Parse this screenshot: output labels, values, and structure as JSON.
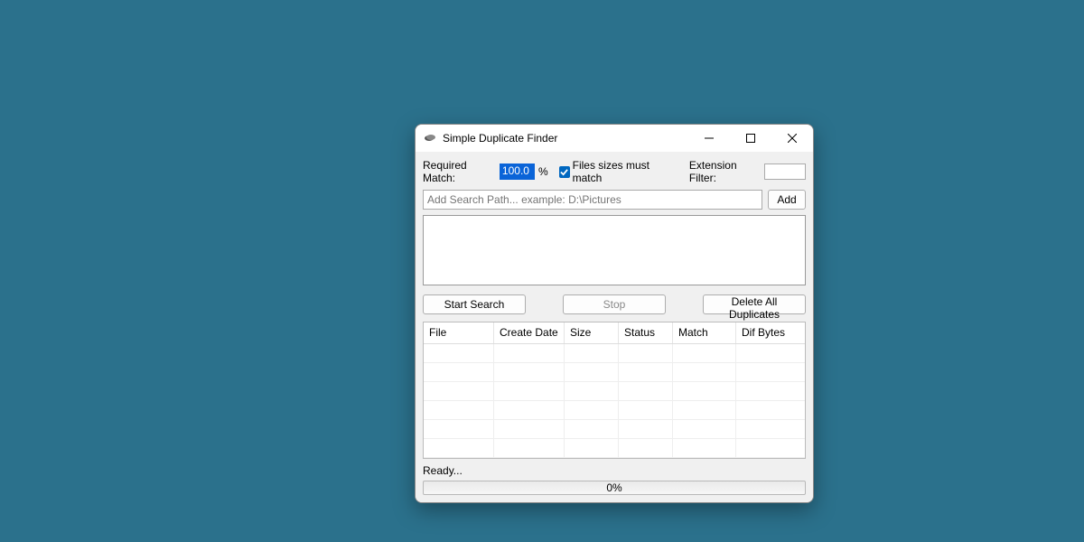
{
  "window": {
    "title": "Simple Duplicate Finder"
  },
  "settings": {
    "required_match_label": "Required Match:",
    "required_match_value": "100.0",
    "percent_sign": "%",
    "sizes_must_match_label": "Files sizes must match",
    "sizes_must_match_checked": true,
    "extension_filter_label": "Extension Filter:",
    "extension_filter_value": ""
  },
  "path": {
    "placeholder": "Add Search Path... example: D:\\Pictures",
    "add_label": "Add"
  },
  "actions": {
    "start_label": "Start Search",
    "stop_label": "Stop",
    "delete_label": "Delete All Duplicates"
  },
  "grid": {
    "columns": {
      "file": "File",
      "create_date": "Create Date",
      "size": "Size",
      "status": "Status",
      "match": "Match",
      "dif_bytes": "Dif Bytes"
    },
    "rows": []
  },
  "status": {
    "text": "Ready...",
    "progress_label": "0%"
  }
}
